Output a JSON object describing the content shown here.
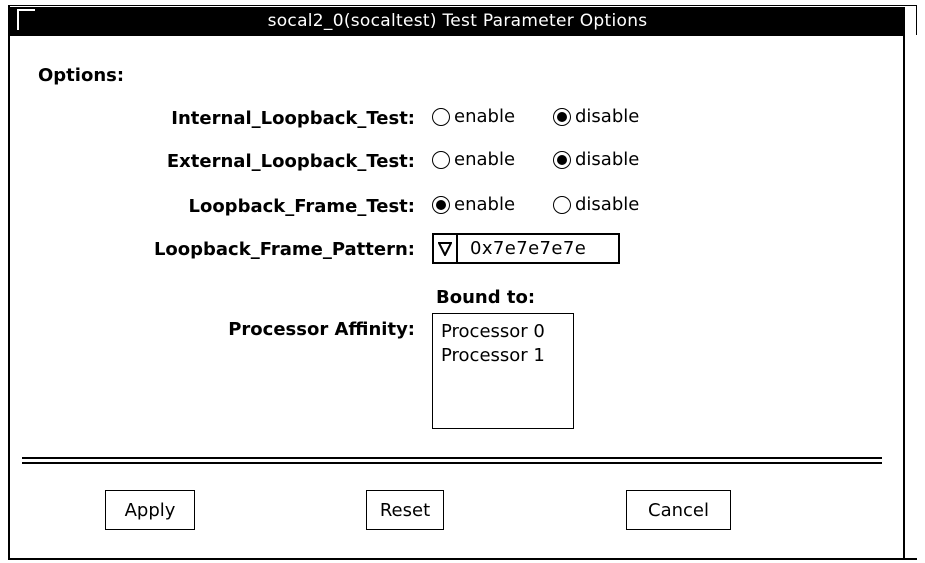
{
  "window": {
    "title": "socal2_0(socaltest) Test Parameter Options"
  },
  "options": {
    "heading": "Options:",
    "rows": [
      {
        "label": "Internal_Loopback_Test:",
        "enable_label": "enable",
        "disable_label": "disable",
        "selected": "disable"
      },
      {
        "label": "External_Loopback_Test:",
        "enable_label": "enable",
        "disable_label": "disable",
        "selected": "disable"
      },
      {
        "label": "Loopback_Frame_Test:",
        "enable_label": "enable",
        "disable_label": "disable",
        "selected": "enable"
      }
    ],
    "pattern": {
      "label": "Loopback_Frame_Pattern:",
      "value": "0x7e7e7e7e"
    },
    "affinity": {
      "label": "Processor Affinity:",
      "bound_label": "Bound to:",
      "items": [
        "Processor 0",
        "Processor 1"
      ]
    }
  },
  "buttons": {
    "apply": "Apply",
    "reset": "Reset",
    "cancel": "Cancel"
  }
}
